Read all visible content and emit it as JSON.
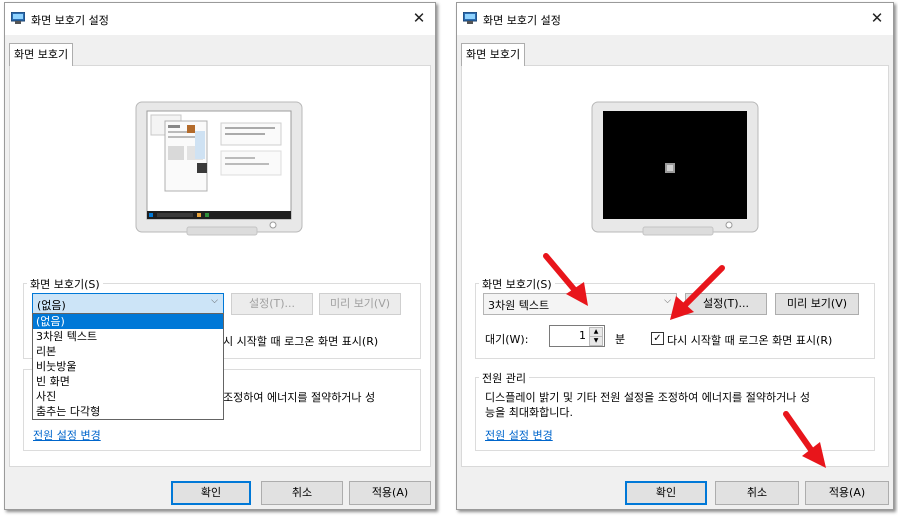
{
  "left_dialog": {
    "title": "화면 보호기 설정",
    "close_glyph": "✕",
    "tab_label": "화면 보호기",
    "screensaver_group_label": "화면 보호기(S)",
    "combo_value": "(없음)",
    "settings_button": "설정(T)...",
    "preview_button": "미리 보기(V)",
    "dropdown_options": [
      "(없음)",
      "3차원 텍스트",
      "리본",
      "비눗방울",
      "빈 화면",
      "사진",
      "춤추는 다각형"
    ],
    "selected_option": "(없음)",
    "resume_partial_text": "시 시작할 때 로그온 화면 표시(R)",
    "power_partial_text": "조정하여 에너지를 절약하거나 성",
    "power_link": "전원 설정 변경",
    "ok_button": "확인",
    "cancel_button": "취소",
    "apply_button": "적용(A)"
  },
  "right_dialog": {
    "title": "화면 보호기 설정",
    "close_glyph": "✕",
    "tab_label": "화면 보호기",
    "screensaver_group_label": "화면 보호기(S)",
    "combo_value": "3차원 텍스트",
    "settings_button": "설정(T)...",
    "preview_button": "미리 보기(V)",
    "wait_label": "대기(W):",
    "wait_value": "1",
    "wait_unit": "분",
    "resume_checked": true,
    "resume_label": "다시 시작할 때 로그온 화면 표시(R)",
    "power_group_label": "전원 관리",
    "power_text_line1": "디스플레이 밝기 및 기타 전원 설정을 조정하여 에너지를 절약하거나 성",
    "power_text_line2": "능을 최대화합니다.",
    "power_link": "전원 설정 변경",
    "ok_button": "확인",
    "cancel_button": "취소",
    "apply_button": "적용(A)"
  },
  "colors": {
    "dialog_bg": "#f0f0f0",
    "accent": "#0078d7",
    "link": "#0066cc",
    "annotation_arrow": "#e8151b"
  }
}
